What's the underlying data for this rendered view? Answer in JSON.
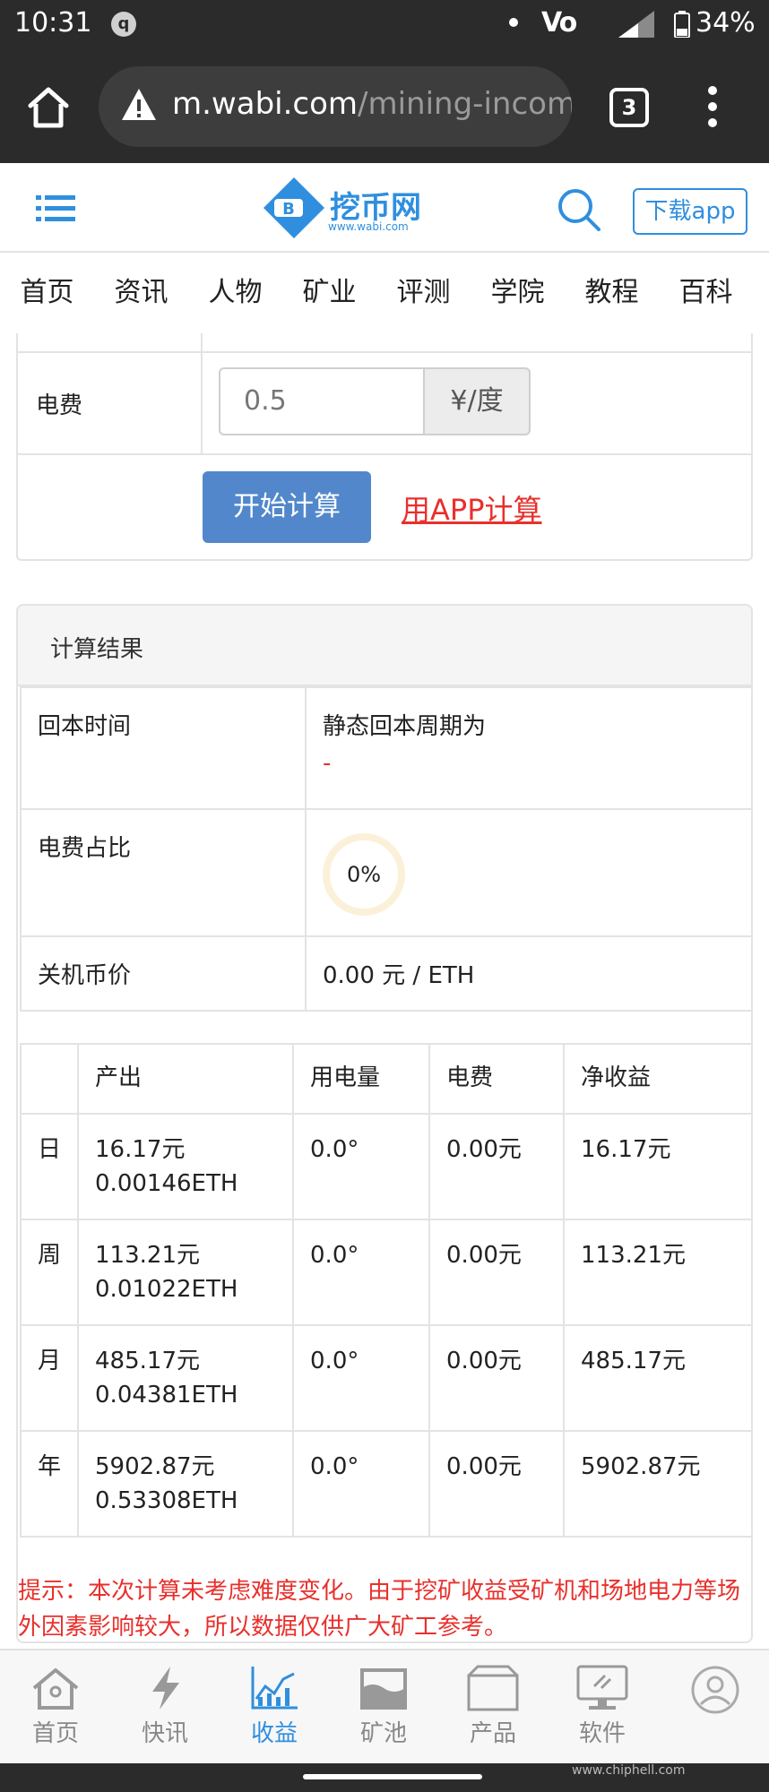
{
  "status_bar": {
    "time": "10:31",
    "volte": "Vo",
    "battery": "34%"
  },
  "browser": {
    "url_host": "m.wabi.com",
    "url_path": "/mining-incom",
    "tab_count": "3"
  },
  "header": {
    "logo_text": "挖币网",
    "logo_sub": "www.wabi.com",
    "download_label": "下载app"
  },
  "nav": [
    "首页",
    "资讯",
    "人物",
    "矿业",
    "评测",
    "学院",
    "教程",
    "百科"
  ],
  "form": {
    "fee_label": "电费",
    "fee_value": "0.5",
    "fee_unit": "¥/度",
    "calc_button": "开始计算",
    "app_calc_link": "用APP计算"
  },
  "results": {
    "title": "计算结果",
    "payback_label": "回本时间",
    "payback_text": "静态回本周期为",
    "payback_value": "-",
    "fee_ratio_label": "电费占比",
    "fee_ratio_value": "0%",
    "shutdown_label": "关机币价",
    "shutdown_value": "0.00 元 / ETH"
  },
  "income_table": {
    "headers": [
      "",
      "产出",
      "用电量",
      "电费",
      "净收益"
    ],
    "rows": [
      {
        "period": "日",
        "output_cny": "16.17元",
        "output_eth": "0.00146ETH",
        "power": "0.0°",
        "fee": "0.00元",
        "net": "16.17元"
      },
      {
        "period": "周",
        "output_cny": "113.21元",
        "output_eth": "0.01022ETH",
        "power": "0.0°",
        "fee": "0.00元",
        "net": "113.21元"
      },
      {
        "period": "月",
        "output_cny": "485.17元",
        "output_eth": "0.04381ETH",
        "power": "0.0°",
        "fee": "0.00元",
        "net": "485.17元"
      },
      {
        "period": "年",
        "output_cny": "5902.87元",
        "output_eth": "0.53308ETH",
        "power": "0.0°",
        "fee": "0.00元",
        "net": "5902.87元"
      }
    ]
  },
  "notice": "提示：本次计算未考虑难度变化。由于挖矿收益受矿机和场地电力等场外因素影响较大，所以数据仅供广大矿工参考。",
  "tabbar": [
    {
      "label": "首页",
      "icon": "home-icon"
    },
    {
      "label": "快讯",
      "icon": "lightning-icon"
    },
    {
      "label": "收益",
      "icon": "chart-icon",
      "active": true
    },
    {
      "label": "矿池",
      "icon": "pool-icon"
    },
    {
      "label": "产品",
      "icon": "box-icon"
    },
    {
      "label": "软件",
      "icon": "monitor-icon"
    }
  ],
  "watermark": "www.chiphell.com",
  "colors": {
    "accent": "#2f8fde",
    "button": "#5288cb",
    "warning": "#e8302c",
    "chrome": "#2b2b2b"
  }
}
